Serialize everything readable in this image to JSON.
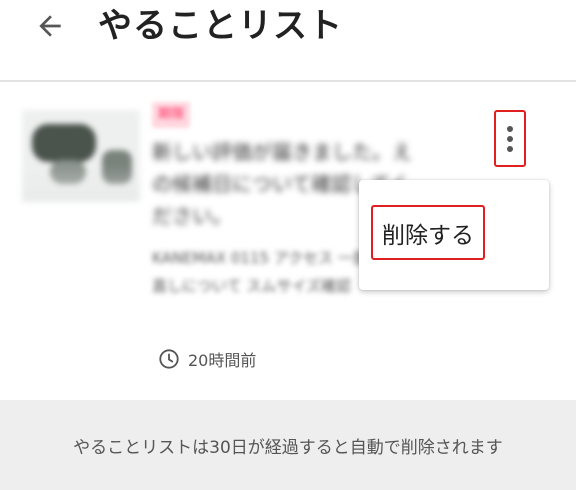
{
  "header": {
    "title": "やることリスト",
    "back_icon": "arrow-back-icon"
  },
  "todo_item": {
    "tag": "期限",
    "title": "新しい評価が届きました。えの候補日について確認してください。",
    "description": "KANEMAX 0115 アクセス 一部時期の見直しについて スムサイズ確認",
    "time": "20時間前",
    "time_icon": "clock-icon",
    "menu_icon": "more-vert-icon"
  },
  "menu": {
    "delete_label": "削除する"
  },
  "footer": {
    "notice": "やることリストは30日が経過すると自動で削除されます"
  },
  "colors": {
    "highlight_border": "#e02020",
    "tag_bg": "#ffd6de",
    "tag_text": "#ff2e63",
    "footer_bg": "#eeeeee"
  }
}
